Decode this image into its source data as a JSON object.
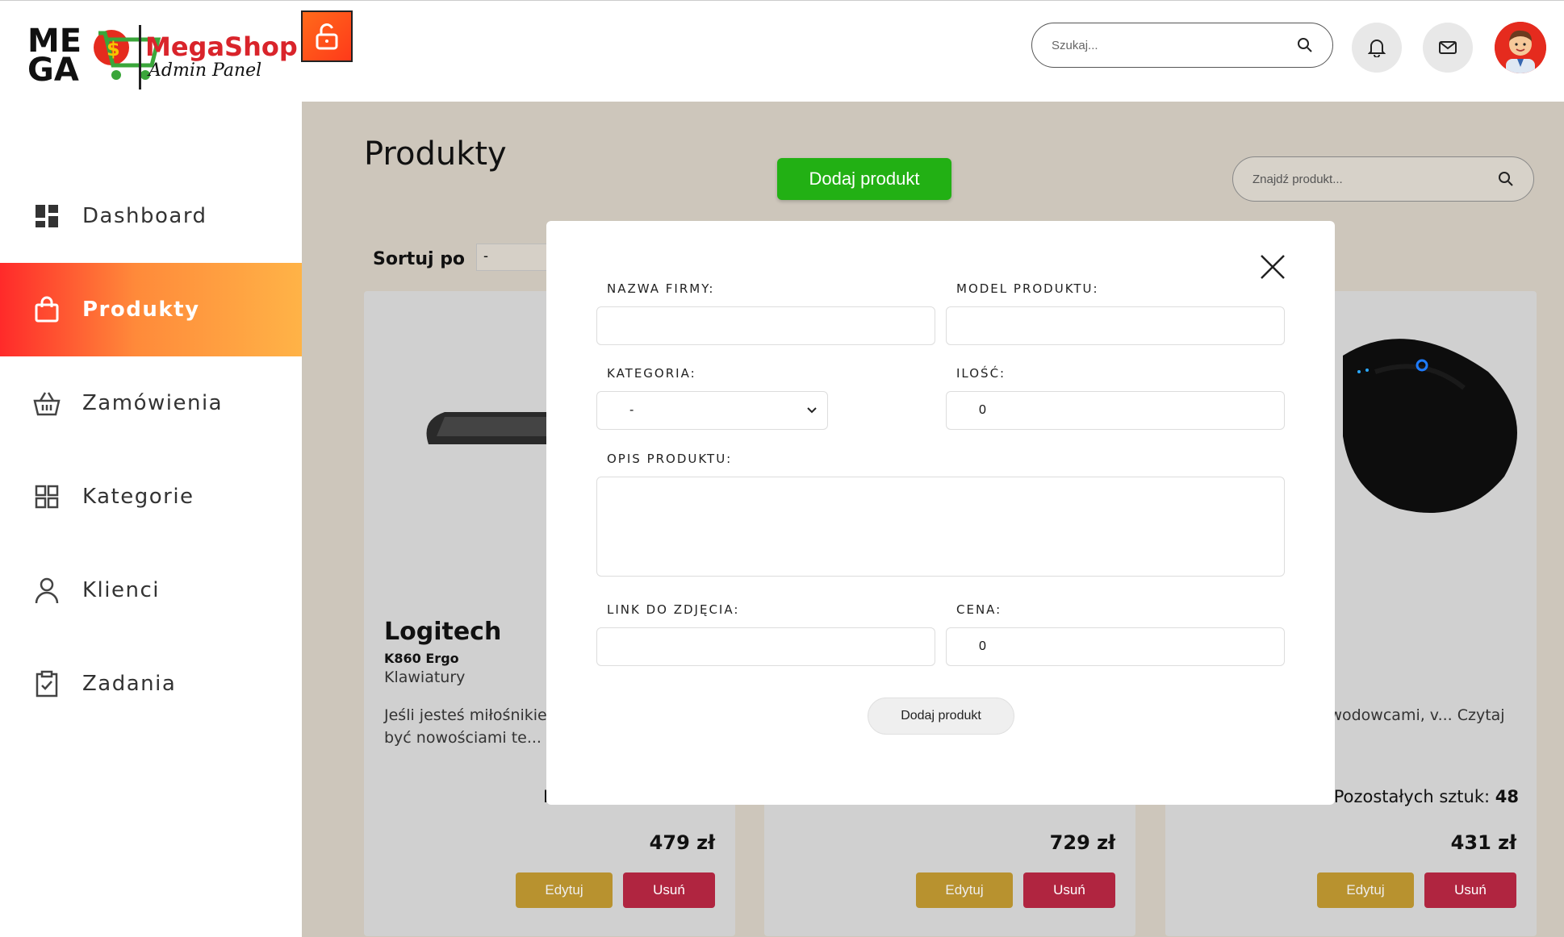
{
  "logo": {
    "mega_line1": "ME",
    "mega_line2": "GA",
    "brand": "MegaShop",
    "subtitle": "Admin Panel"
  },
  "header": {
    "search_placeholder": "Szukaj..."
  },
  "sidebar": {
    "items": [
      {
        "label": "Dashboard",
        "icon": "dashboard-icon",
        "active": false
      },
      {
        "label": "Produkty",
        "icon": "shopping-bag-icon",
        "active": true
      },
      {
        "label": "Zamówienia",
        "icon": "basket-icon",
        "active": false
      },
      {
        "label": "Kategorie",
        "icon": "grid-icon",
        "active": false
      },
      {
        "label": "Klienci",
        "icon": "user-icon",
        "active": false
      },
      {
        "label": "Zadania",
        "icon": "clipboard-check-icon",
        "active": false
      }
    ]
  },
  "main": {
    "title": "Produkty",
    "add_button": "Dodaj produkt",
    "search_placeholder": "Znajdź produkt...",
    "sort_label": "Sortuj po",
    "sort_value": "-"
  },
  "products": [
    {
      "brand": "Logitech",
      "model": "K860 Ergo",
      "category": "Klawiatury",
      "description": "Jeśli jesteś miłośnikiem elektroniki - lubisz być nowościami te... Czytaj",
      "stock_label": "P",
      "price": "479 zł",
      "edit": "Edytuj",
      "delete": "Usuń"
    },
    {
      "brand": "",
      "model": "",
      "category": "",
      "description": "",
      "stock_label": "",
      "price": "729 zł",
      "edit": "Edytuj",
      "delete": "Usuń"
    },
    {
      "brand": "",
      "model": "",
      "category": "",
      "description": "Wireless Gaming z zawodowcami, v... Czytaj więcej",
      "stock_label": "Pozostałych sztuk:",
      "stock_value": "48",
      "price": "431 zł",
      "edit": "Edytuj",
      "delete": "Usuń"
    }
  ],
  "modal": {
    "company_label": "NAZWA FIRMY:",
    "company_value": "",
    "model_label": "MODEL PRODUKTU:",
    "model_value": "",
    "category_label": "KATEGORIA:",
    "category_value": "-",
    "quantity_label": "ILOŚĆ:",
    "quantity_value": "0",
    "description_label": "OPIS PRODUKTU:",
    "image_label": "LINK DO ZDJĘCIA:",
    "image_value": "",
    "price_label": "CENA:",
    "price_value": "0",
    "submit": "Dodaj produkt"
  },
  "colors": {
    "accent": "#ff2a2a",
    "accent_end": "#ffb347",
    "green": "#22b014",
    "edit": "#b8922f",
    "delete": "#b02540",
    "background": "#cdc6bb"
  }
}
